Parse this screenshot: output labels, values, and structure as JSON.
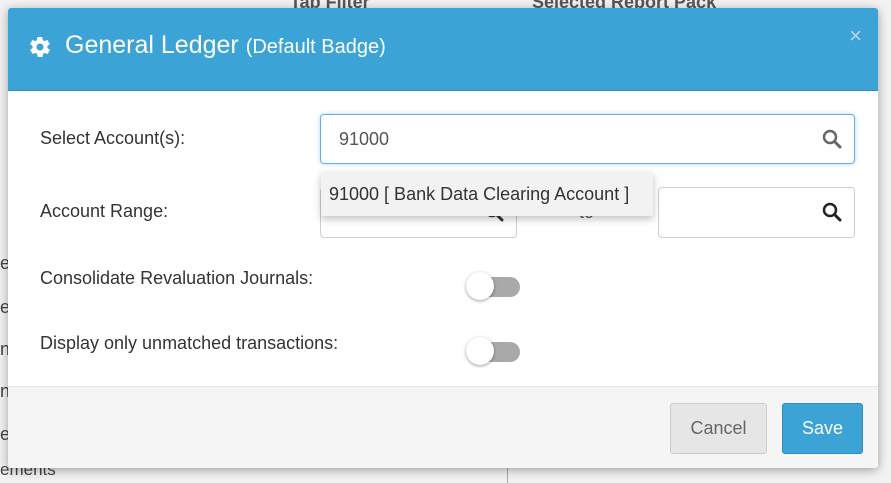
{
  "background": {
    "column_headers": [
      "Tab Filter",
      "Selected Report Pack"
    ],
    "left_fragments": [
      "e",
      "e",
      "n",
      "n",
      "e"
    ],
    "bottom_fragment": "ements"
  },
  "modal": {
    "title": "General Ledger",
    "subtitle": "(Default Badge)",
    "title_icon": "gear-icon",
    "close_label": "×",
    "accent_color": "#3ca3d6"
  },
  "form": {
    "select_accounts": {
      "label": "Select Account(s):",
      "value": "91000",
      "icon": "search-icon"
    },
    "suggestion": "91000 [ Bank Data Clearing Account ]",
    "account_range": {
      "label": "Account Range:",
      "to_label": "to",
      "from_value": "",
      "to_value": ""
    },
    "consolidate": {
      "label": "Consolidate Revaluation Journals:",
      "enabled": false
    },
    "unmatched": {
      "label": "Display only unmatched transactions:",
      "enabled": false
    }
  },
  "footer": {
    "cancel_label": "Cancel",
    "save_label": "Save"
  }
}
